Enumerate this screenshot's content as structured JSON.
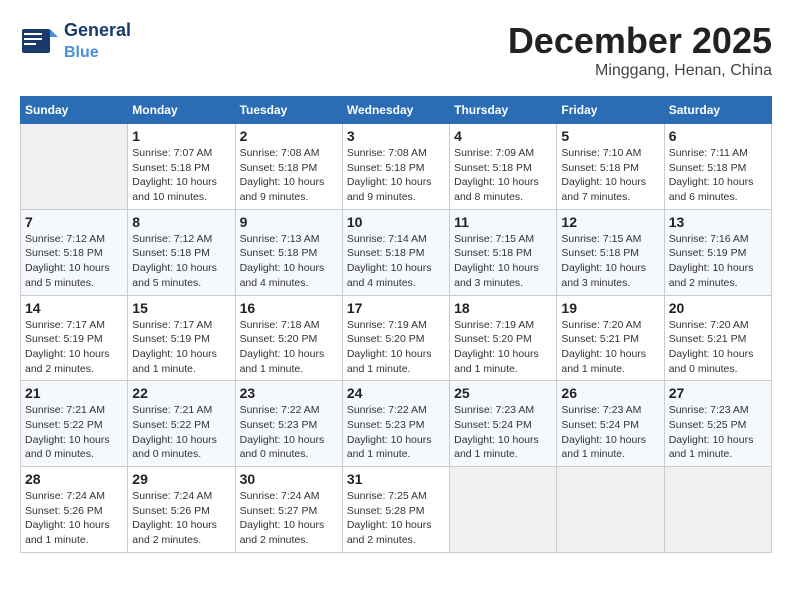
{
  "header": {
    "logo_text_general": "General",
    "logo_text_blue": "Blue",
    "month": "December 2025",
    "location": "Minggang, Henan, China"
  },
  "days_of_week": [
    "Sunday",
    "Monday",
    "Tuesday",
    "Wednesday",
    "Thursday",
    "Friday",
    "Saturday"
  ],
  "weeks": [
    [
      {
        "day": "",
        "empty": true
      },
      {
        "day": "1",
        "sunrise": "7:07 AM",
        "sunset": "5:18 PM",
        "daylight": "10 hours and 10 minutes."
      },
      {
        "day": "2",
        "sunrise": "7:08 AM",
        "sunset": "5:18 PM",
        "daylight": "10 hours and 9 minutes."
      },
      {
        "day": "3",
        "sunrise": "7:08 AM",
        "sunset": "5:18 PM",
        "daylight": "10 hours and 9 minutes."
      },
      {
        "day": "4",
        "sunrise": "7:09 AM",
        "sunset": "5:18 PM",
        "daylight": "10 hours and 8 minutes."
      },
      {
        "day": "5",
        "sunrise": "7:10 AM",
        "sunset": "5:18 PM",
        "daylight": "10 hours and 7 minutes."
      },
      {
        "day": "6",
        "sunrise": "7:11 AM",
        "sunset": "5:18 PM",
        "daylight": "10 hours and 6 minutes."
      }
    ],
    [
      {
        "day": "7",
        "sunrise": "7:12 AM",
        "sunset": "5:18 PM",
        "daylight": "10 hours and 5 minutes."
      },
      {
        "day": "8",
        "sunrise": "7:12 AM",
        "sunset": "5:18 PM",
        "daylight": "10 hours and 5 minutes."
      },
      {
        "day": "9",
        "sunrise": "7:13 AM",
        "sunset": "5:18 PM",
        "daylight": "10 hours and 4 minutes."
      },
      {
        "day": "10",
        "sunrise": "7:14 AM",
        "sunset": "5:18 PM",
        "daylight": "10 hours and 4 minutes."
      },
      {
        "day": "11",
        "sunrise": "7:15 AM",
        "sunset": "5:18 PM",
        "daylight": "10 hours and 3 minutes."
      },
      {
        "day": "12",
        "sunrise": "7:15 AM",
        "sunset": "5:18 PM",
        "daylight": "10 hours and 3 minutes."
      },
      {
        "day": "13",
        "sunrise": "7:16 AM",
        "sunset": "5:19 PM",
        "daylight": "10 hours and 2 minutes."
      }
    ],
    [
      {
        "day": "14",
        "sunrise": "7:17 AM",
        "sunset": "5:19 PM",
        "daylight": "10 hours and 2 minutes."
      },
      {
        "day": "15",
        "sunrise": "7:17 AM",
        "sunset": "5:19 PM",
        "daylight": "10 hours and 1 minute."
      },
      {
        "day": "16",
        "sunrise": "7:18 AM",
        "sunset": "5:20 PM",
        "daylight": "10 hours and 1 minute."
      },
      {
        "day": "17",
        "sunrise": "7:19 AM",
        "sunset": "5:20 PM",
        "daylight": "10 hours and 1 minute."
      },
      {
        "day": "18",
        "sunrise": "7:19 AM",
        "sunset": "5:20 PM",
        "daylight": "10 hours and 1 minute."
      },
      {
        "day": "19",
        "sunrise": "7:20 AM",
        "sunset": "5:21 PM",
        "daylight": "10 hours and 1 minute."
      },
      {
        "day": "20",
        "sunrise": "7:20 AM",
        "sunset": "5:21 PM",
        "daylight": "10 hours and 0 minutes."
      }
    ],
    [
      {
        "day": "21",
        "sunrise": "7:21 AM",
        "sunset": "5:22 PM",
        "daylight": "10 hours and 0 minutes."
      },
      {
        "day": "22",
        "sunrise": "7:21 AM",
        "sunset": "5:22 PM",
        "daylight": "10 hours and 0 minutes."
      },
      {
        "day": "23",
        "sunrise": "7:22 AM",
        "sunset": "5:23 PM",
        "daylight": "10 hours and 0 minutes."
      },
      {
        "day": "24",
        "sunrise": "7:22 AM",
        "sunset": "5:23 PM",
        "daylight": "10 hours and 1 minute."
      },
      {
        "day": "25",
        "sunrise": "7:23 AM",
        "sunset": "5:24 PM",
        "daylight": "10 hours and 1 minute."
      },
      {
        "day": "26",
        "sunrise": "7:23 AM",
        "sunset": "5:24 PM",
        "daylight": "10 hours and 1 minute."
      },
      {
        "day": "27",
        "sunrise": "7:23 AM",
        "sunset": "5:25 PM",
        "daylight": "10 hours and 1 minute."
      }
    ],
    [
      {
        "day": "28",
        "sunrise": "7:24 AM",
        "sunset": "5:26 PM",
        "daylight": "10 hours and 1 minute."
      },
      {
        "day": "29",
        "sunrise": "7:24 AM",
        "sunset": "5:26 PM",
        "daylight": "10 hours and 2 minutes."
      },
      {
        "day": "30",
        "sunrise": "7:24 AM",
        "sunset": "5:27 PM",
        "daylight": "10 hours and 2 minutes."
      },
      {
        "day": "31",
        "sunrise": "7:25 AM",
        "sunset": "5:28 PM",
        "daylight": "10 hours and 2 minutes."
      },
      {
        "day": "",
        "empty": true
      },
      {
        "day": "",
        "empty": true
      },
      {
        "day": "",
        "empty": true
      }
    ]
  ],
  "labels": {
    "sunrise": "Sunrise:",
    "sunset": "Sunset:",
    "daylight": "Daylight:"
  }
}
